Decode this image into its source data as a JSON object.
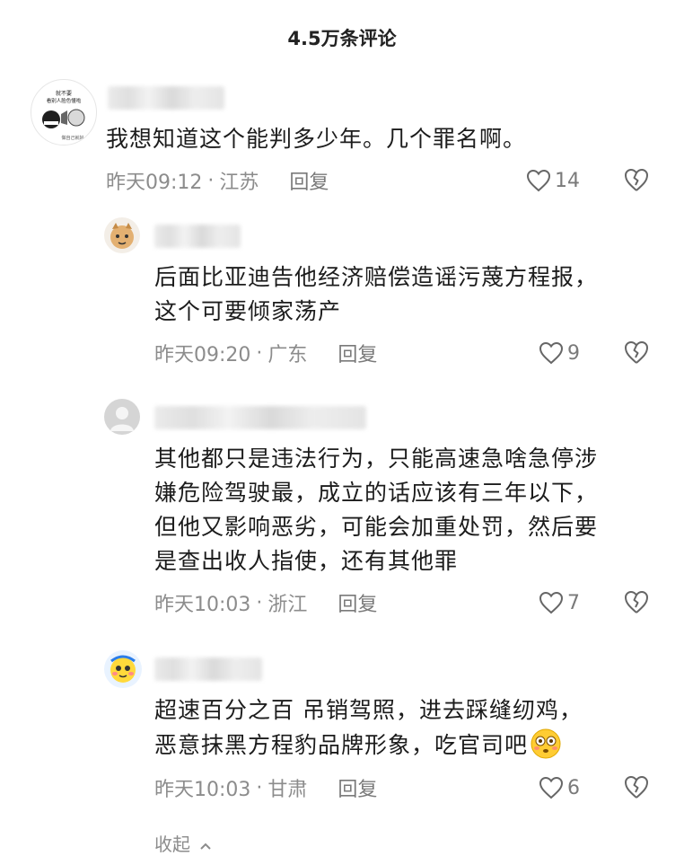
{
  "header": {
    "title": "4.5万条评论"
  },
  "comments": [
    {
      "text": "我想知道这个能判多少年。几个罪名啊。",
      "time": "昨天09:12",
      "region": "江苏",
      "reply_label": "回复",
      "likes": "14"
    },
    {
      "text_lines": [
        "后面比亚迪告他经济赔偿造谣污蔑方程报，",
        "这个可要倾家荡产"
      ],
      "time": "昨天09:20",
      "region": "广东",
      "reply_label": "回复",
      "likes": "9"
    },
    {
      "text_lines": [
        "其他都只是违法行为，只能高速急啥急停涉",
        "嫌危险驾驶最，成立的话应该有三年以下，",
        "但他又影响恶劣，可能会加重处罚，然后要",
        "是查出收人指使，还有其他罪"
      ],
      "time": "昨天10:03",
      "region": "浙江",
      "reply_label": "回复",
      "likes": "7"
    },
    {
      "text_lines": [
        "超速百分之百 吊销驾照，进去踩缝纫鸡，",
        "恶意抹黑方程豹品牌形象，吃官司吧"
      ],
      "time": "昨天10:03",
      "region": "甘肃",
      "reply_label": "回复",
      "likes": "6"
    }
  ],
  "avatar_texts": {
    "line1": "就不要",
    "line2": "看别人脸色懂啦",
    "line3": "做自己就好"
  },
  "collapse_label": "收起",
  "separator": "·"
}
